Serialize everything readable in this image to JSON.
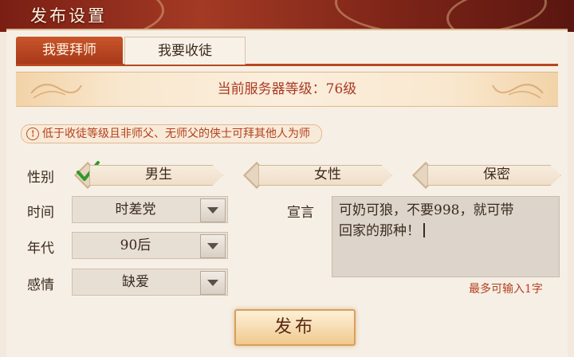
{
  "window": {
    "title": "发布设置"
  },
  "tabs": [
    {
      "label": "我要拜师",
      "active": true
    },
    {
      "label": "我要收徒",
      "active": false
    }
  ],
  "server": {
    "text": "当前服务器等级：76级"
  },
  "notice": {
    "text": "低于收徒等级且非师父、无师父的侠士可拜其他人为师",
    "icon": "exclamation-icon"
  },
  "form": {
    "gender": {
      "label": "性别",
      "options": [
        {
          "label": "男生",
          "selected": true
        },
        {
          "label": "女性",
          "selected": false
        },
        {
          "label": "保密",
          "selected": false
        }
      ]
    },
    "time": {
      "label": "时间",
      "value": "时差党"
    },
    "era": {
      "label": "年代",
      "value": "90后"
    },
    "emotion": {
      "label": "感情",
      "value": "缺爱"
    },
    "declaration": {
      "label": "宣言",
      "line1": "可奶可狼，不要998，就可带",
      "line2": "回家的那种！",
      "hint_prefix": "最多可输入",
      "hint_count": "1",
      "hint_suffix": "字"
    }
  },
  "publish": {
    "label": "发布"
  },
  "colors": {
    "accent": "#b8471f",
    "highlight": "#a93a22",
    "check": "#2f9a2c"
  }
}
